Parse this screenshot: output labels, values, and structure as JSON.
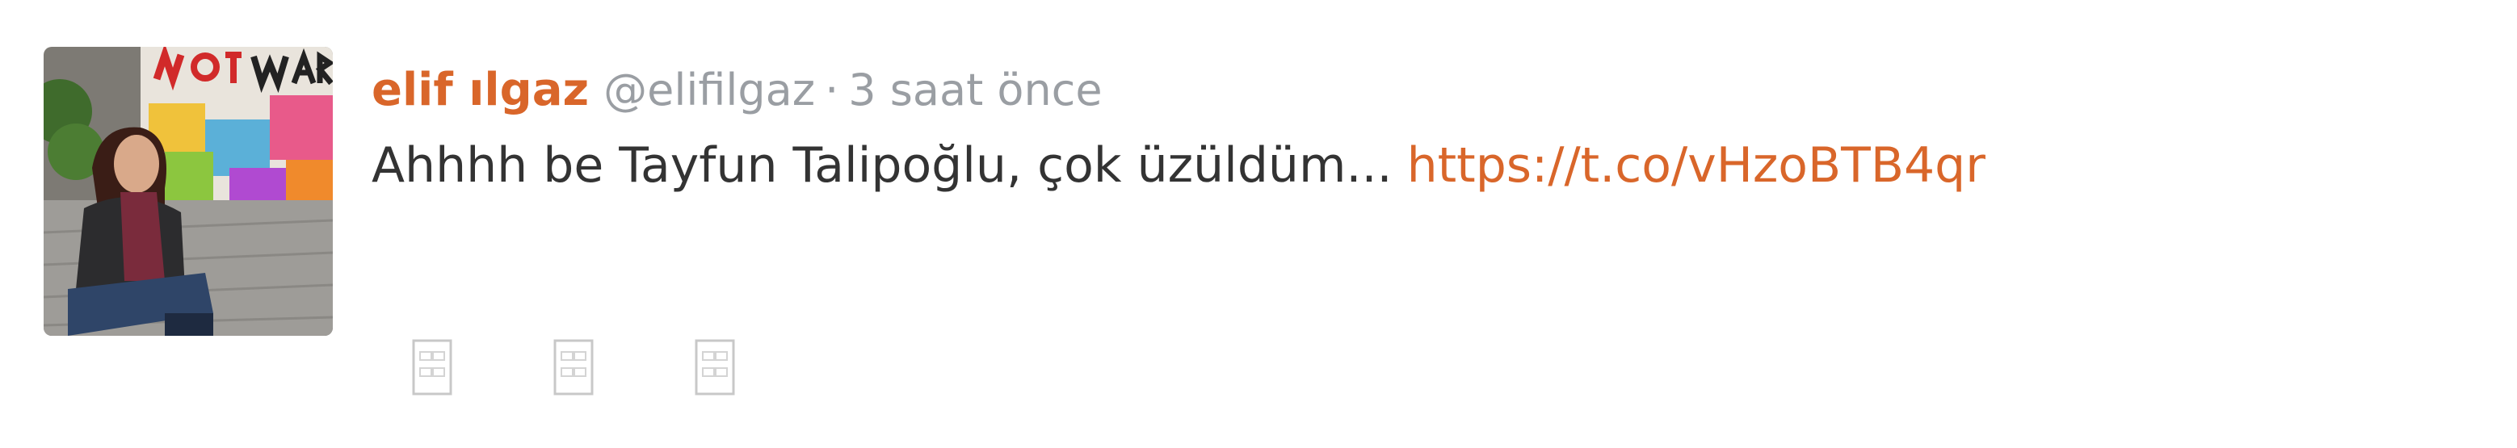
{
  "tweet": {
    "author": {
      "display_name": "elif ılgaz",
      "screen_name": "@elifilgaz",
      "avatar_graffiti_text": "NOT WAR"
    },
    "separator": "·",
    "timestamp": "3 saat önce",
    "text": "Ahhhh be Tayfun Talipoğlu, çok üzüldüm...",
    "link": "https://t.co/vHzoBTB4qr",
    "actions": [
      {
        "name": "reply",
        "icon": "reply-icon"
      },
      {
        "name": "retweet",
        "icon": "retweet-icon"
      },
      {
        "name": "favorite",
        "icon": "favorite-icon"
      }
    ]
  },
  "colors": {
    "accent": "#d9662a",
    "muted": "#9a9ea3",
    "text": "#333333",
    "icon": "#c8c8c8"
  }
}
